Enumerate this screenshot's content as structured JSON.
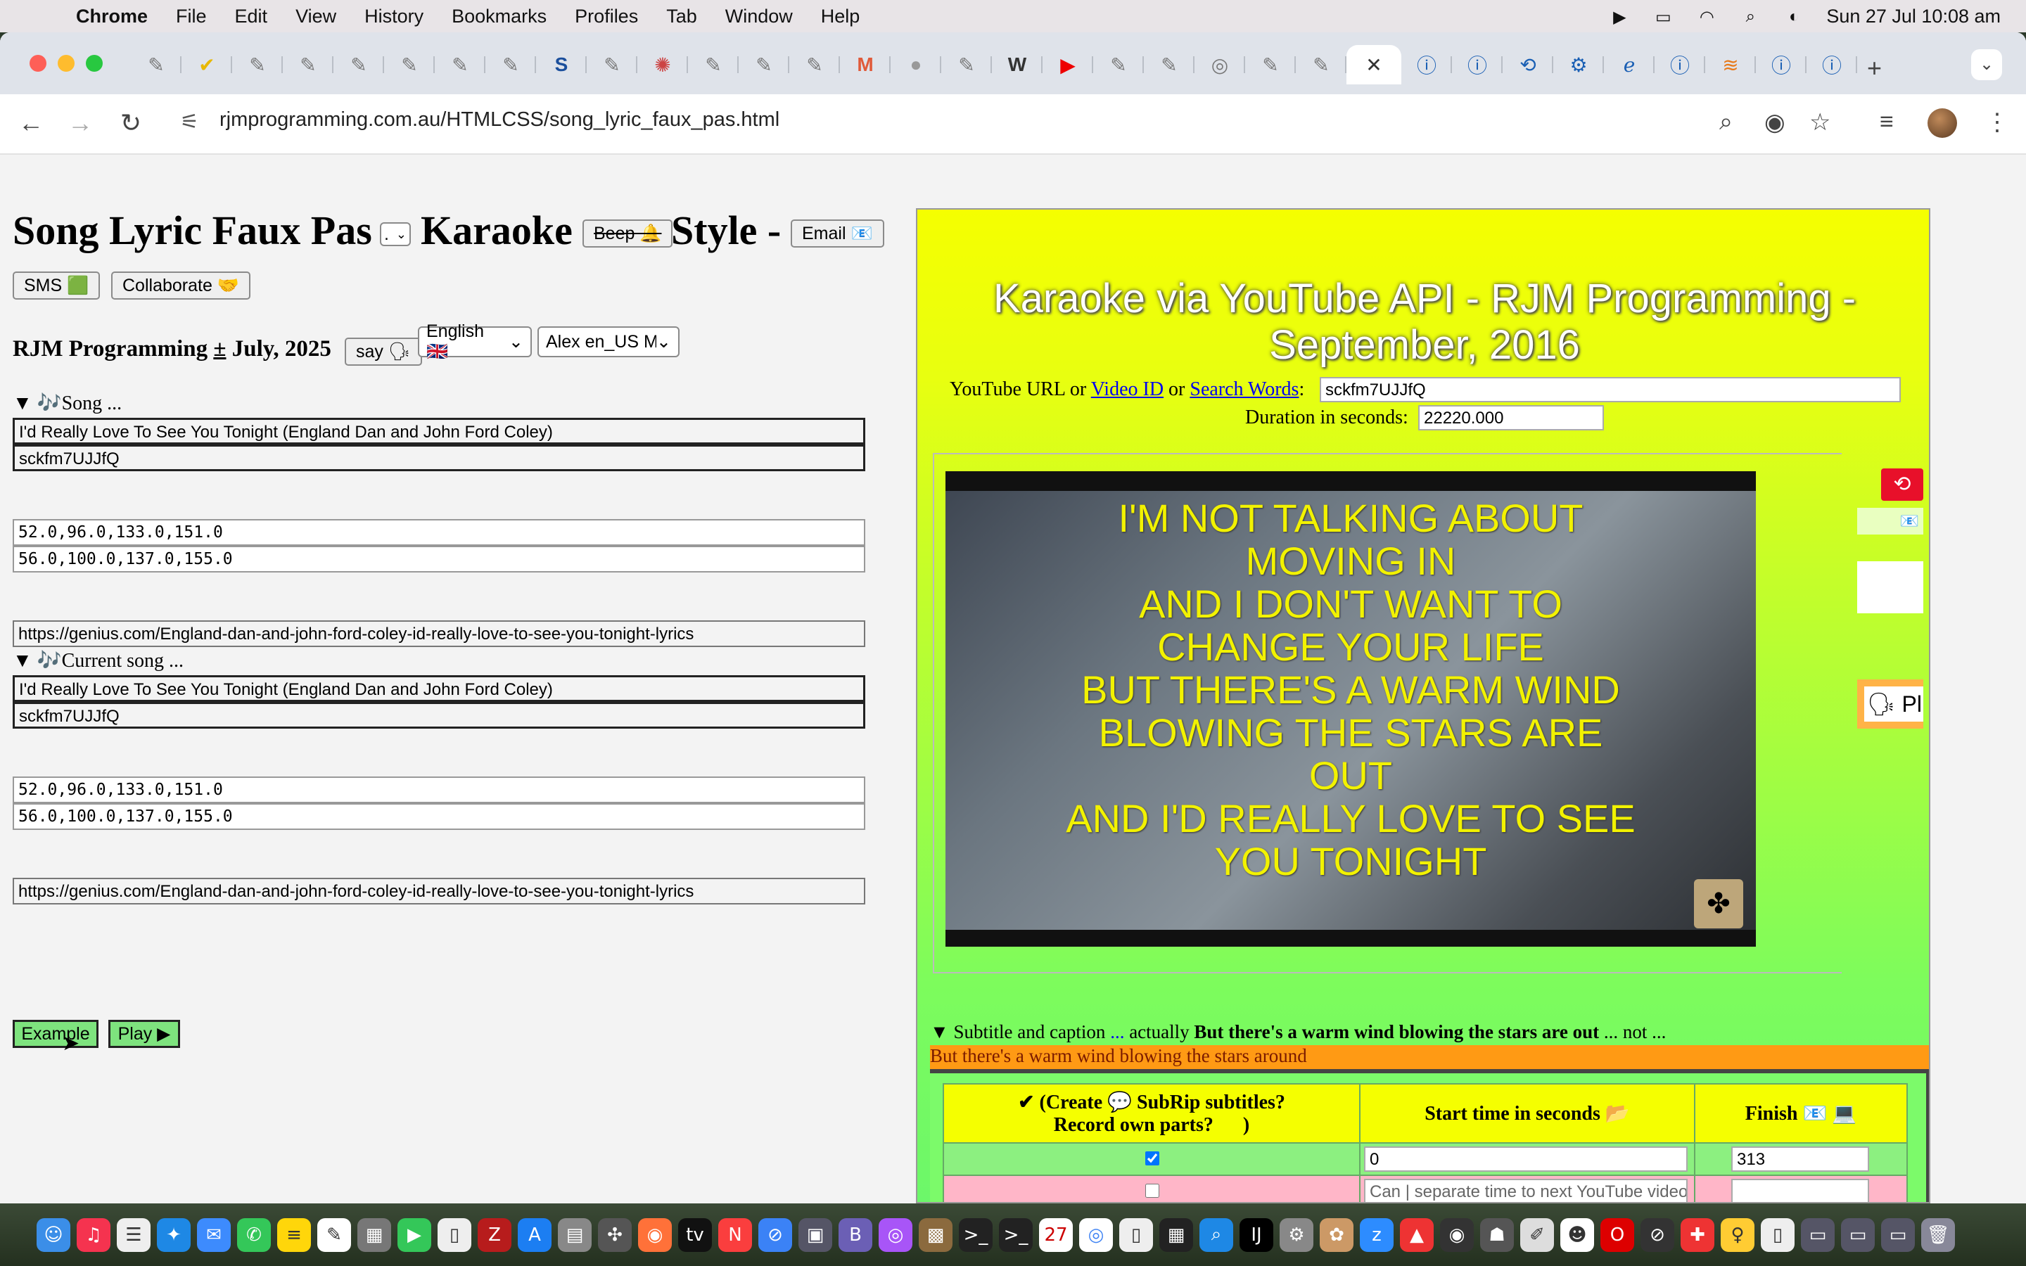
{
  "menubar": {
    "apple": "",
    "app": "Chrome",
    "items": [
      "File",
      "Edit",
      "View",
      "History",
      "Bookmarks",
      "Profiles",
      "Tab",
      "Window",
      "Help"
    ],
    "datetime": "Sun 27 Jul  10:08 am"
  },
  "browser": {
    "url": "rjmprogramming.com.au/HTMLCSS/song_lyric_faux_pas.html",
    "active_tab_close": "✕",
    "new_tab": "+"
  },
  "page": {
    "title_part1": "Song Lyric Faux Pas",
    "title_part2": "Karaoke",
    "title_part3": "Style -",
    "select_dot": ".",
    "beep_label": "Beep 🔔",
    "email_label": "Email 📧",
    "sms_label": "SMS 🟩",
    "collaborate_label": "Collaborate 🤝",
    "byline_a": "RJM Programming",
    "byline_pm": "±",
    "byline_b": "July, 2025",
    "say_label": "say 🗣",
    "language_value": "English 🇬🇧",
    "voice_value": "Alex en_US Mo",
    "song_summary": "▼ 🎶Song ...",
    "song_title": "I'd Really Love To See You Tonight (England Dan and John Ford Coley)",
    "video_id": "sckfm7UJJfQ",
    "times_start": "52.0,96.0,133.0,151.0",
    "times_end": "56.0,100.0,137.0,155.0",
    "lyrics_url": "https://genius.com/England-dan-and-john-ford-coley-id-really-love-to-see-you-tonight-lyrics",
    "current_summary": "▼ 🎶Current song ...",
    "current_song_title": "I'd Really Love To See You Tonight (England Dan and John Ford Coley)",
    "current_video_id": "sckfm7UJJfQ",
    "current_times_start": "52.0,96.0,133.0,151.0",
    "current_times_end": "56.0,100.0,137.0,155.0",
    "current_lyrics_url": "https://genius.com/England-dan-and-john-ford-coley-id-really-love-to-see-you-tonight-lyrics",
    "example_label": "Example",
    "play_label": "Play ▶"
  },
  "karaoke": {
    "title": "Karaoke via YouTube API - RJM Programming - September, 2016",
    "url_label_a": "YouTube URL or",
    "url_link_video": "Video ID",
    "url_label_or": "or",
    "url_link_search": "Search Words",
    "url_colon": ":",
    "url_value": "sckfm7UJJfQ",
    "duration_label": "Duration in seconds:",
    "duration_value": "22220.000",
    "lyrics_lines": [
      "I'M NOT TALKING ABOUT",
      "MOVING IN",
      "AND I DON'T WANT TO",
      "CHANGE YOUR LIFE",
      "BUT THERE'S A WARM WIND",
      "BLOWING THE STARS ARE",
      "OUT",
      "AND I'D REALLY LOVE TO SEE",
      "YOU TONIGHT"
    ],
    "side_play": "🗣 Pl",
    "subtitle_prefix": "▼ Subtitle and caption",
    "subtitle_link": "...",
    "subtitle_actually": "actually",
    "subtitle_actual": "But there's a warm wind blowing the stars are out",
    "subtitle_not": "... not ...",
    "subtitle_wrong": "But there's a warm wind blowing the stars around",
    "table": {
      "col1_prefix": "✔ (",
      "col1_create": "Create",
      "col1_mid": " 💬 SubRip ",
      "col1_subtitles": "subtitles",
      "col1_q": "?",
      "col1_record": "Record",
      "col1_rest": " own parts?      )",
      "col2": "Start time in seconds 📂",
      "col3": "Finish 📧 💻",
      "row1_start": "0",
      "row1_finish": "313",
      "row2_start_placeholder": "Can | separate time to next YouTube video",
      "row2_finish": ""
    }
  }
}
